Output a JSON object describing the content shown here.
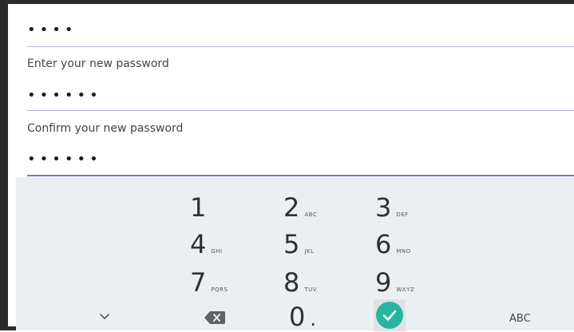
{
  "fields": {
    "current_password_masked": "••••",
    "new_password_label": "Enter your new password",
    "new_password_masked": "••••••",
    "confirm_password_label": "Confirm your new password",
    "confirm_password_masked": "••••••"
  },
  "keypad": {
    "keys": [
      {
        "digit": "1",
        "letters": ""
      },
      {
        "digit": "2",
        "letters": "ABC"
      },
      {
        "digit": "3",
        "letters": "DEF"
      },
      {
        "digit": "4",
        "letters": "GHI"
      },
      {
        "digit": "5",
        "letters": "JKL"
      },
      {
        "digit": "6",
        "letters": "MNO"
      },
      {
        "digit": "7",
        "letters": "PQRS"
      },
      {
        "digit": "8",
        "letters": "TUV"
      },
      {
        "digit": "9",
        "letters": "WXYZ"
      }
    ],
    "zero": "0",
    "dot": ".",
    "abc_label": "ABC",
    "icons": {
      "collapse": "chevron-down-icon",
      "backspace": "backspace-icon",
      "done": "checkmark-icon"
    },
    "colors": {
      "done_accent": "#26b5a0",
      "field_underline": "#7c78b8",
      "keyboard_bg": "#eceff1"
    }
  }
}
